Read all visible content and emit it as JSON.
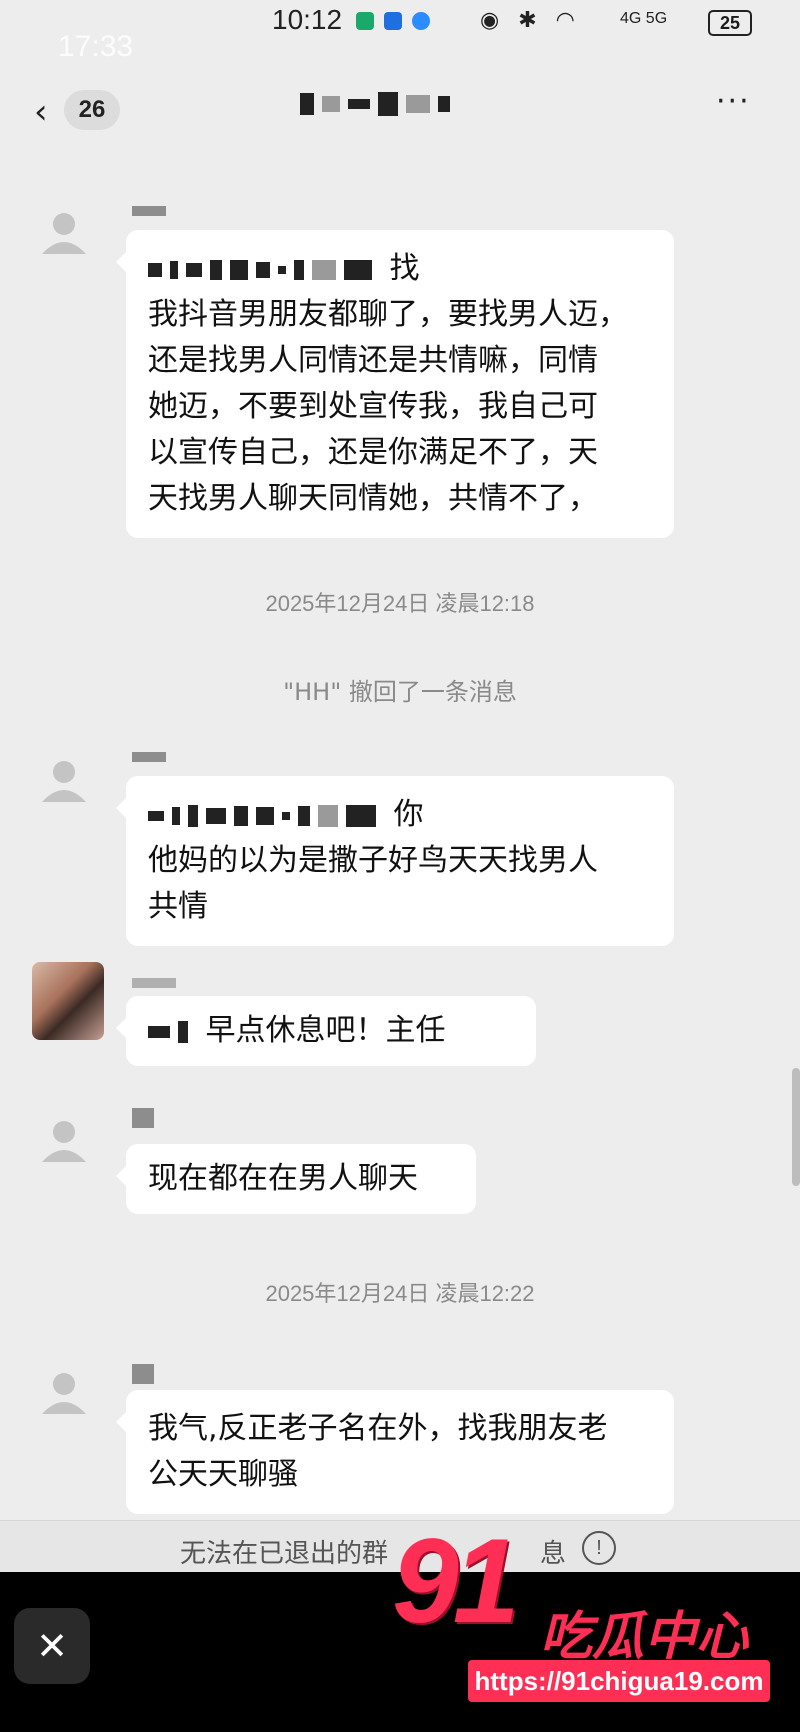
{
  "status_bar": {
    "time": "10:12",
    "time_ghost": "17:33",
    "network": "4G 5G",
    "battery": "25"
  },
  "header": {
    "back_count": "26",
    "more": "···"
  },
  "messages": [
    {
      "text_tail": "找",
      "text_lines": [
        "我抖音男朋友都聊了，要找男人迈，",
        "还是找男人同情还是共情嘛，同情",
        "她迈，不要到处宣传我，我自己可",
        "以宣传自己，还是你满足不了，天",
        "天找男人聊天同情她，共情不了，"
      ]
    },
    {
      "text_tail": "你",
      "text_lines": [
        "他妈的以为是撒子好鸟天天找男人",
        "共情"
      ]
    },
    {
      "text": "早点休息吧！主任"
    },
    {
      "text": "现在都在在男人聊天"
    },
    {
      "text_lines": [
        "我气,反正老子名在外，找我朋友老",
        "公天天聊骚"
      ]
    }
  ],
  "timestamps": [
    "2025年12月24日 凌晨12:18",
    "2025年12月24日 凌晨12:22"
  ],
  "system_message": "\"HH\" 撤回了一条消息",
  "bottom_notice": "无法在已退出的群",
  "bottom_notice_tail": "息",
  "watermark": {
    "number": "91",
    "chinese": "吃瓜中心",
    "url": "https://91chigua19.com"
  },
  "overlay": {
    "close": "✕"
  }
}
